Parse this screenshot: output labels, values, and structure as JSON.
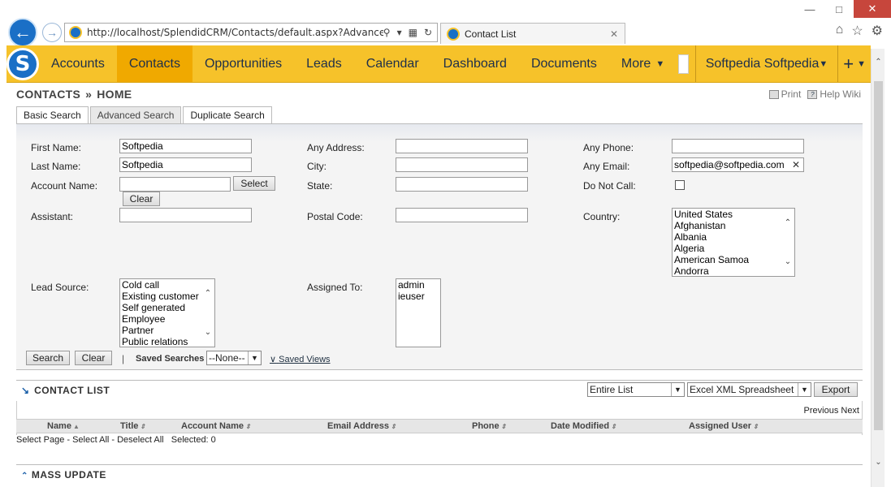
{
  "browser": {
    "url": "http://localhost/SplendidCRM/Contacts/default.aspx?Advanced=1",
    "tab_title": "Contact List"
  },
  "nav": {
    "logo_letter": "S",
    "items": [
      "Accounts",
      "Contacts",
      "Opportunities",
      "Leads",
      "Calendar",
      "Dashboard",
      "Documents"
    ],
    "more_label": "More",
    "user_name": "Softpedia Softpedia",
    "plus_label": "+"
  },
  "breadcrumb": {
    "module": "CONTACTS",
    "sep": "»",
    "page": "HOME"
  },
  "page_links": {
    "print": "Print",
    "help": "Help Wiki"
  },
  "search_tabs": [
    "Basic Search",
    "Advanced Search",
    "Duplicate Search"
  ],
  "form": {
    "first_name_label": "First Name:",
    "first_name_value": "Softpedia",
    "last_name_label": "Last Name:",
    "last_name_value": "Softpedia",
    "account_name_label": "Account Name:",
    "account_name_value": "",
    "select_label": "Select",
    "clear_label": "Clear",
    "assistant_label": "Assistant:",
    "assistant_value": "",
    "lead_source_label": "Lead Source:",
    "lead_sources": [
      "Cold call",
      "Existing customer",
      "Self generated",
      "Employee",
      "Partner",
      "Public relations"
    ],
    "any_address_label": "Any Address:",
    "city_label": "City:",
    "state_label": "State:",
    "postal_code_label": "Postal Code:",
    "assigned_to_label": "Assigned To:",
    "assigned_users": [
      "admin",
      "ieuser"
    ],
    "any_phone_label": "Any Phone:",
    "any_email_label": "Any Email:",
    "any_email_value": "softpedia@softpedia.com",
    "do_not_call_label": "Do Not Call:",
    "country_label": "Country:",
    "countries": [
      "United States",
      "Afghanistan",
      "Albania",
      "Algeria",
      "American Samoa",
      "Andorra"
    ],
    "search_button": "Search",
    "clear_button": "Clear",
    "divider": "|",
    "saved_searches_label": "Saved Searches",
    "saved_searches_value": "--None--",
    "saved_views_label": "Saved Views"
  },
  "contact_list": {
    "title": "CONTACT LIST",
    "scope_value": "Entire List",
    "format_value": "Excel XML Spreadsheet",
    "export_label": "Export",
    "pager": "Previous Next",
    "columns": [
      "Name",
      "Title",
      "Account Name",
      "Email Address",
      "Phone",
      "Date Modified",
      "Assigned User"
    ],
    "selection": "Select Page - Select All - Deselect All   Selected: 0"
  },
  "mass_update": {
    "title": "MASS UPDATE"
  }
}
